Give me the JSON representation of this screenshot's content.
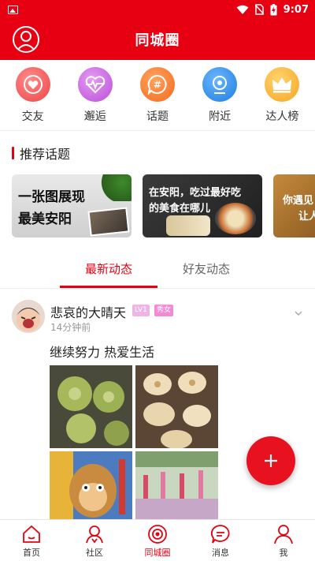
{
  "status_bar": {
    "time": "9:07",
    "icons": [
      "image-icon",
      "wifi-icon",
      "no-sim-icon",
      "battery-charging-icon"
    ]
  },
  "header": {
    "title": "同城圈",
    "avatar_icon": "user-avatar-icon"
  },
  "quick_entries": [
    {
      "label": "交友",
      "icon": "heart-icon",
      "color": "#f25a5a"
    },
    {
      "label": "邂逅",
      "icon": "heartbeat-icon",
      "color": "#c25ee0"
    },
    {
      "label": "话题",
      "icon": "hashtag-chat-icon",
      "color": "#fb7c2d"
    },
    {
      "label": "附近",
      "icon": "nearby-camera-icon",
      "color": "#2f8ef0"
    },
    {
      "label": "达人榜",
      "icon": "crown-icon",
      "color": "#f7b73c"
    }
  ],
  "recommend": {
    "title": "推荐话题",
    "topics": [
      {
        "line1": "一张图展现",
        "line2": "最美安阳"
      },
      {
        "line1": "在安阳，吃过最好吃",
        "line2": "的美食在哪儿"
      },
      {
        "line1": "你遇见",
        "line2": "让人"
      }
    ]
  },
  "tabs": {
    "active": "最新动态",
    "inactive": "好友动态"
  },
  "post": {
    "user_name": "悲哀的大晴天",
    "level_badge": "LV1",
    "gender_badge": "秀女",
    "time": "14分钟前",
    "text": "继续努力 热爱生活"
  },
  "fab": {
    "icon": "plus-icon"
  },
  "bottom_nav": [
    {
      "label": "首页",
      "icon": "home-icon"
    },
    {
      "label": "社区",
      "icon": "community-icon"
    },
    {
      "label": "同城圈",
      "icon": "city-circle-icon",
      "active": true
    },
    {
      "label": "消息",
      "icon": "message-icon"
    },
    {
      "label": "我",
      "icon": "profile-icon"
    }
  ],
  "colors": {
    "brand": "#e60012",
    "badge_level": "#f0b3e8",
    "badge_gender": "#f28ad6"
  }
}
